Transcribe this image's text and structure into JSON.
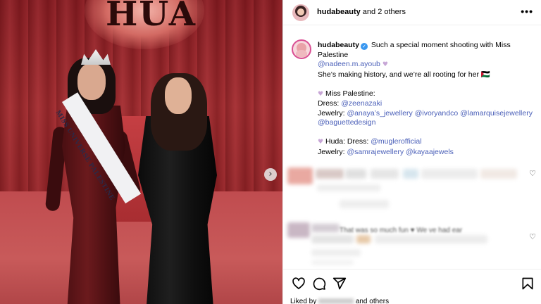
{
  "post": {
    "header": {
      "username": "hudabeauty",
      "coauthors": " and 2 others",
      "more_icon": "more-horizontal-icon"
    },
    "caption": {
      "username": "hudabeauty",
      "line1": "Such a special moment shooting with Miss Palestine",
      "mention_nadeen": "@nadeen.m.ayoub",
      "line2": "She’s making history, and we’re all rooting for her 🇵🇸",
      "miss_palestine_label": "Miss Palestine:",
      "dress_label": "Dress:",
      "dress_mention": "@zeenazaki",
      "jewelry_label": "Jewelry:",
      "jewelry_mention1": "@anaya’s_jewellery",
      "jewelry_mention2": "@ivoryandco",
      "jewelry_mention3": "@lamarquisejewellery",
      "jewelry_mention4": "@baguettedesign",
      "huda_label": "Huda: Dress:",
      "huda_dress_mention": "@muglerofficial",
      "huda_jewelry_label": "Jewelry:",
      "huda_jewelry_mention1": "@samrajewellery",
      "huda_jewelry_mention2": "@kayaajewels"
    },
    "photo": {
      "sash_text": "MISS UNIVERSE PALESTINE",
      "next_icon": "chevron-right-icon"
    },
    "comments": {
      "partial_text": "That was so much fun ♥ We ve had ear"
    },
    "actions": {
      "like_icon": "heart-icon",
      "comment_icon": "comment-icon",
      "share_icon": "share-icon",
      "save_icon": "bookmark-icon"
    },
    "likes": {
      "prefix": "Liked by",
      "suffix": "and others"
    }
  },
  "colors": {
    "link": "#4a5fb8",
    "verified": "#3897f0",
    "curtain": "#a42a2e"
  }
}
